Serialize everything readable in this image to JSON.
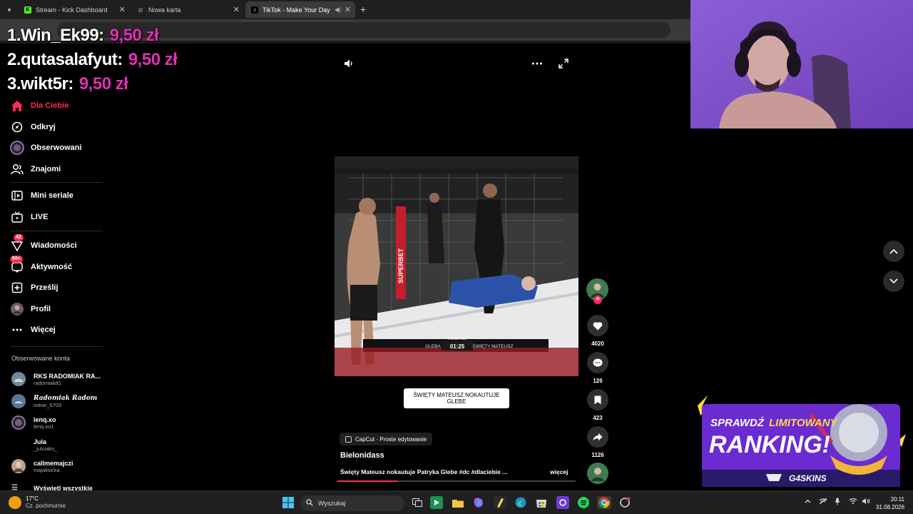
{
  "browser": {
    "tabs": [
      {
        "title": "Stream - Kick Dashboard",
        "favicon": "kick-icon"
      },
      {
        "title": "Nowa karta",
        "favicon": "globe-icon"
      },
      {
        "title": "TikTok - Make Your Day",
        "favicon": "tiktok-icon",
        "active": true
      }
    ],
    "new_tab": "+"
  },
  "donations": [
    {
      "rank": "1.",
      "name": "Win_Ek99:",
      "amount": "9,50 zł"
    },
    {
      "rank": "2.",
      "name": "qutasalafyut:",
      "amount": "9,50 zł"
    },
    {
      "rank": "3.",
      "name": "wikt5r:",
      "amount": "9,50 zł"
    }
  ],
  "sidebar": {
    "items": [
      {
        "label": "Dla Ciebie",
        "icon": "home-icon"
      },
      {
        "label": "Odkryj",
        "icon": "compass-icon"
      },
      {
        "label": "Obserwowani",
        "icon": "following-icon"
      },
      {
        "label": "Znajomi",
        "icon": "friends-icon"
      },
      {
        "label": "Mini seriale",
        "icon": "film-icon"
      },
      {
        "label": "LIVE",
        "icon": "tv-icon"
      },
      {
        "label": "Wiadomości",
        "icon": "send-icon",
        "badge": "42"
      },
      {
        "label": "Aktywność",
        "icon": "activity-icon",
        "badge": "99+"
      },
      {
        "label": "Prześlij",
        "icon": "upload-icon"
      },
      {
        "label": "Profil",
        "icon": "profile-avatar"
      },
      {
        "label": "Więcej",
        "icon": "more-icon"
      }
    ],
    "followed_title": "Obserwowane konta",
    "followed": [
      {
        "name": "RKS RADOMIAK RA...",
        "handle": "radomiak81"
      },
      {
        "name": "Radomiak Radom",
        "handle": "oskar_6703"
      },
      {
        "name": "lenq.xo",
        "handle": "lenq.xo1"
      },
      {
        "name": "Jula",
        "handle": "_julciakn_"
      },
      {
        "name": "callmemajczi",
        "handle": "majalisicka"
      }
    ],
    "show_all": "Wyświetl wszystkie"
  },
  "video": {
    "scoreboard": {
      "left": "GLEBA",
      "time": "01:25",
      "right": "ŚWIĘTY MATEUSZ",
      "round": "RUNDA 1/3"
    },
    "sponsor": "SUPERBET",
    "caption": "ŚWIĘTY MATEUSZ NOKAUTUJE GLEBE",
    "capcut": "CapCut · Proste edytowanie",
    "author": "Bielonidass",
    "description": "Święty Mateusz nokautuje Patryka Glebe #dc #dlaciebie ...",
    "more": "więcej",
    "progress": 0.25
  },
  "actions": {
    "likes": "4020",
    "comments": "126",
    "saves": "423",
    "shares": "1126"
  },
  "promo": {
    "line1a": "SPRAWDŹ",
    "line1b": "LIMITOWANY",
    "line2": "RANKING!",
    "brand": "G4SKINS"
  },
  "taskbar": {
    "temp": "17°C",
    "weather": "Cz. pochmurnie",
    "search": "Wyszukaj",
    "time": "20:11",
    "date": "31.08.2026"
  },
  "colors": {
    "accent": "#fe2c55",
    "donation": "#e22fb5"
  }
}
